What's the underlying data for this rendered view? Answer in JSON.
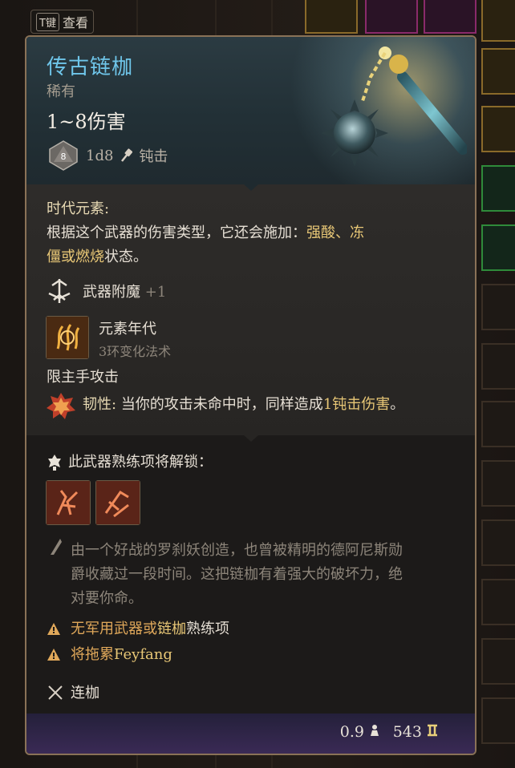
{
  "hint": {
    "key": "T键",
    "label": "查看"
  },
  "item": {
    "name": "传古链枷",
    "rarity": "稀有",
    "damage": "1~8伤害",
    "die_face": "8",
    "dice": "1d8",
    "damage_type": "钝击"
  },
  "colors": {
    "name": "#6fc6ea",
    "highlight": "#e8c776",
    "border": "#8a7257",
    "warning": "#e0a85a"
  },
  "effect": {
    "title": "时代元素:",
    "desc_line1_pre": "根据这个武器的伤害类型，它还会施加：",
    "desc_line1_hl": "强酸、冻",
    "desc_line2_hl": "僵或燃烧",
    "desc_line2_post": "状态。"
  },
  "enchant": {
    "label": "武器附魔",
    "bonus": "+1"
  },
  "spell": {
    "name": "元素年代",
    "sub": "3环变化法术"
  },
  "restriction": "限主手攻击",
  "passive": {
    "name": "韧性:",
    "desc_pre": "当你的攻击未命中时，同样造成",
    "desc_hl": "1钝击伤害",
    "desc_post": "。"
  },
  "proficiency": {
    "label": "此武器熟练项将解锁："
  },
  "lore": [
    "由一个好战的罗刹妖创造，也曾被精明的德阿尼斯勋",
    "爵收藏过一段时间。这把链枷有着强大的破坏力，绝",
    "对要你命。"
  ],
  "warnings": [
    {
      "pre": "无军用武器或",
      "hl": "链枷",
      "post": "熟练项"
    },
    {
      "pre": "将拖累",
      "hl": "Feyfang",
      "post": ""
    }
  ],
  "weapon_type": "连枷",
  "footer": {
    "weight": "0.9",
    "price": "543"
  }
}
